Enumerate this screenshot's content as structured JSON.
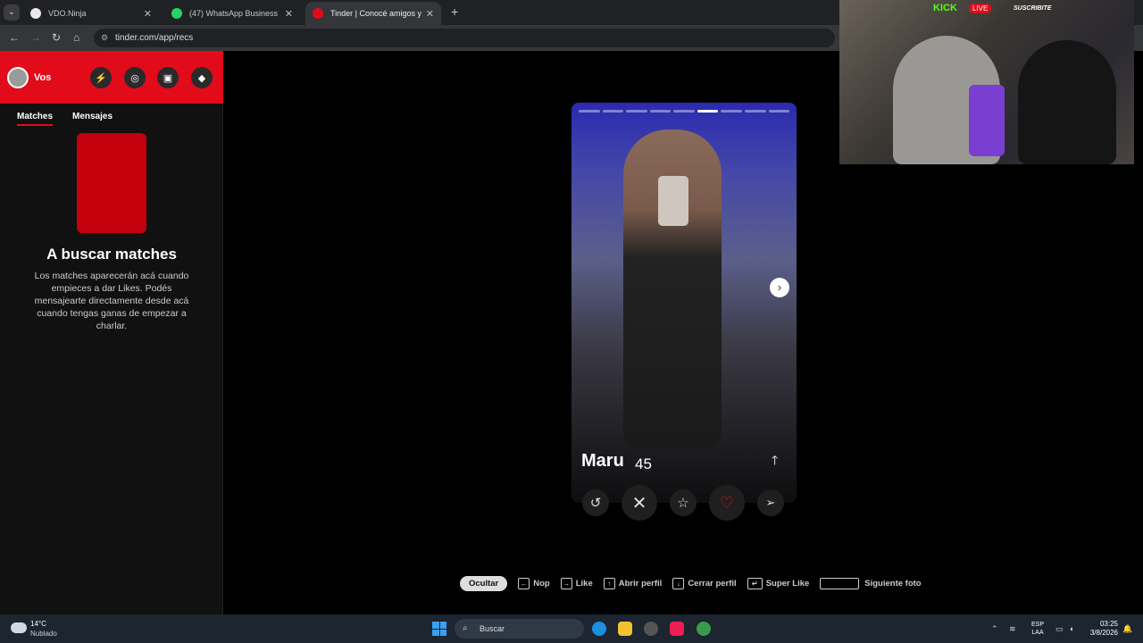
{
  "browser": {
    "tabs": [
      {
        "label": "VDO.Ninja",
        "icon": "vdo-ninja-favicon",
        "color": "#e8e8e8"
      },
      {
        "label": "(47) WhatsApp Business",
        "icon": "whatsapp-favicon",
        "color": "#25d366"
      },
      {
        "label": "Tinder | Conocé amigos y gente",
        "icon": "tinder-favicon",
        "color": "#e20b1a"
      }
    ],
    "url": "tinder.com/app/recs"
  },
  "sidebar": {
    "user": "Vos",
    "tabs": [
      "Matches",
      "Mensajes"
    ],
    "heading": "A buscar matches",
    "description": "Los matches aparecerán acá cuando empieces a dar Likes. Podés mensajearte directamente desde acá cuando tengas ganas de empezar a charlar."
  },
  "card": {
    "name": "Maru",
    "age": "45",
    "photo_count": 9,
    "current_photo": 6,
    "actions": [
      "rewind-icon",
      "nope-icon",
      "super-like-icon",
      "like-icon",
      "boost-icon"
    ]
  },
  "hints": {
    "toggle": "Ocultar",
    "items": [
      {
        "key": "←",
        "label": "Nop"
      },
      {
        "key": "→",
        "label": "Like"
      },
      {
        "key": "↑",
        "label": "Abrir perfil"
      },
      {
        "key": "↓",
        "label": "Cerrar perfil"
      },
      {
        "key": "↵",
        "label": "Super Like"
      },
      {
        "key": "",
        "label": "Siguiente foto"
      }
    ]
  },
  "stream_overlay": {
    "kick": "KICK",
    "live": "LIVE",
    "subscribe": "SUSCRIBITE"
  },
  "taskbar": {
    "temperature": "14°C",
    "condition": "Nublado",
    "search_placeholder": "Buscar",
    "language": "ESP",
    "layout": "LAA",
    "time": "03:25",
    "date": "3/8/2026"
  }
}
